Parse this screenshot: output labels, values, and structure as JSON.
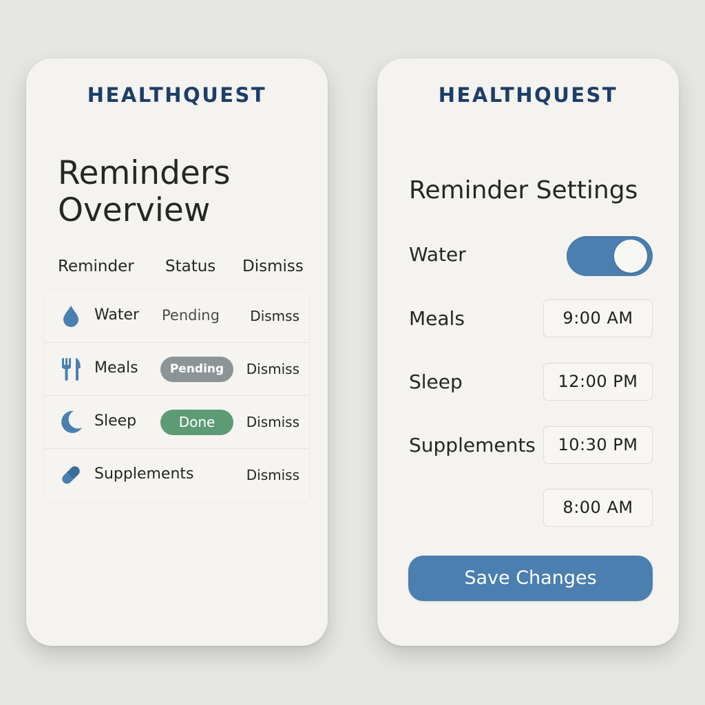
{
  "colors": {
    "brand": "#1d3e67",
    "accent": "#4a7fb0",
    "pending": "#8d9496",
    "done": "#5d9b75"
  },
  "overview": {
    "brand": "HEALTHQUEST",
    "title_line1": "Reminders",
    "title_line2": "Overview",
    "columns": {
      "reminder": "Reminder",
      "status": "Status",
      "dismiss": "Dismiss"
    },
    "rows": [
      {
        "icon": "water-drop-icon",
        "label": "Water",
        "status": "Pending",
        "status_style": "text",
        "dismiss": "Dismss"
      },
      {
        "icon": "fork-knife-icon",
        "label": "Meals",
        "status": "Pending",
        "status_style": "pill-pending",
        "dismiss": "Dismiss"
      },
      {
        "icon": "moon-icon",
        "label": "Sleep",
        "status": "Done",
        "status_style": "pill-done",
        "dismiss": "Dismiss"
      },
      {
        "icon": "pill-icon",
        "label": "Supplements",
        "status": "",
        "status_style": "none",
        "dismiss": "Dismiss"
      }
    ]
  },
  "settings": {
    "brand": "HEALTHQUEST",
    "title": "Reminder Settings",
    "water_label": "Water",
    "water_enabled": true,
    "meals_label": "Meals",
    "sleep_label": "Sleep",
    "supplements_label": "Supplements",
    "times": [
      "9:00 AM",
      "12:00 PM",
      "10:30 PM",
      "8:00 AM"
    ],
    "save_label": "Save Changes"
  }
}
